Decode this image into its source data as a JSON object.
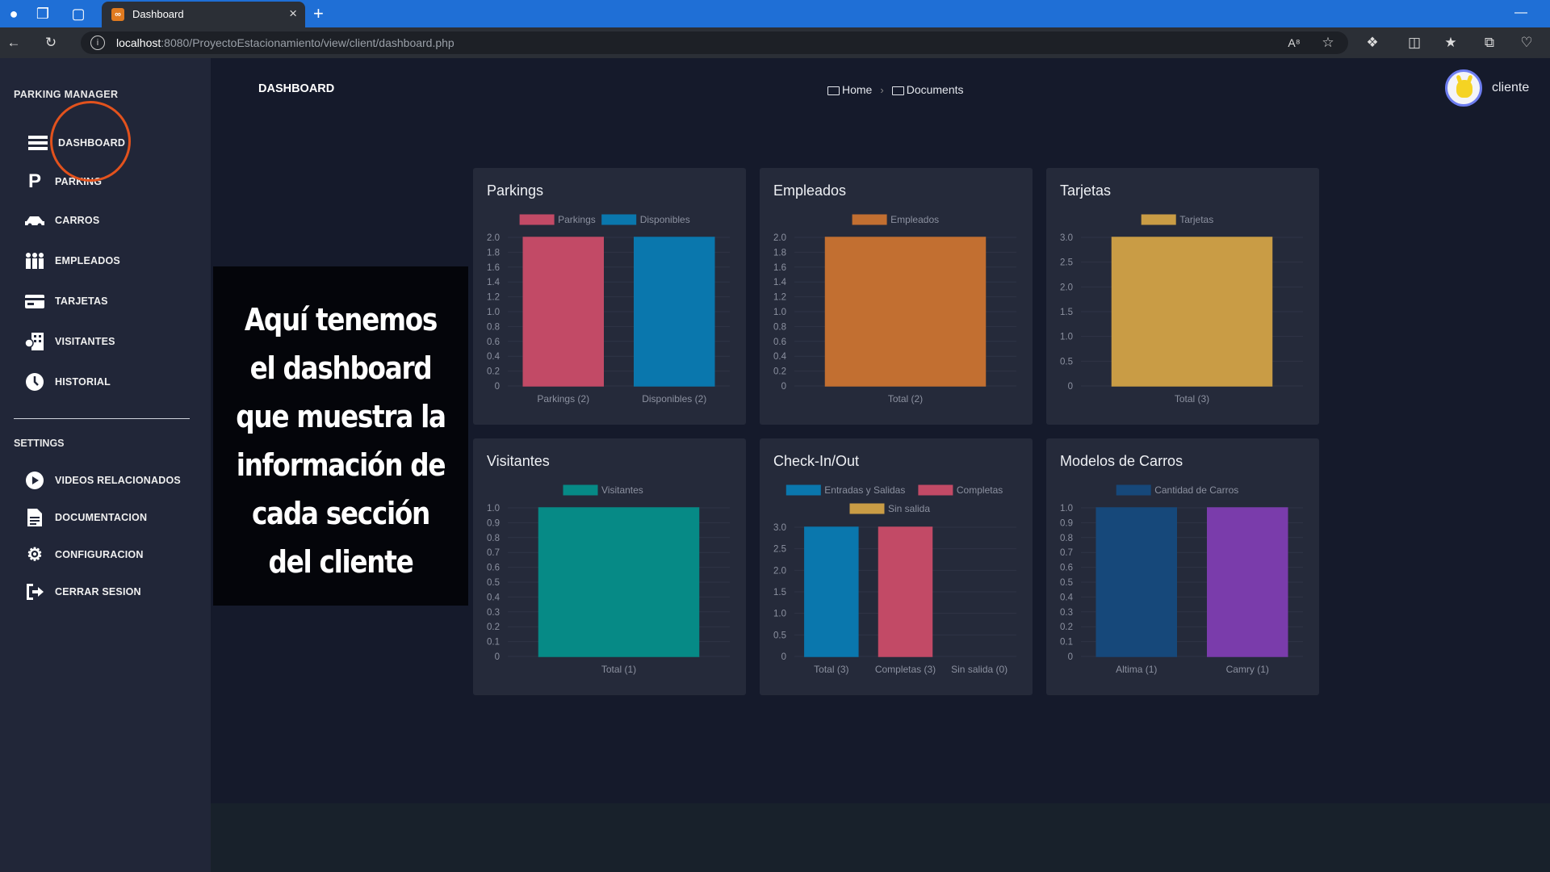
{
  "browser": {
    "tab_title": "Dashboard",
    "url_host": "localhost",
    "url_path": ":8080/ProyectoEstacionamiento/view/client/dashboard.php"
  },
  "sidebar": {
    "brand": "PARKING MANAGER",
    "items": [
      {
        "label": "DASHBOARD",
        "icon": "menu-icon"
      },
      {
        "label": "PARKING",
        "icon": "parking-icon"
      },
      {
        "label": "CARROS",
        "icon": "car-icon"
      },
      {
        "label": "EMPLEADOS",
        "icon": "people-icon"
      },
      {
        "label": "TARJETAS",
        "icon": "card-icon"
      },
      {
        "label": "VISITANTES",
        "icon": "visitor-icon"
      },
      {
        "label": "HISTORIAL",
        "icon": "clock-icon"
      }
    ],
    "settings_title": "SETTINGS",
    "settings": [
      {
        "label": "VIDEOS RELACIONADOS",
        "icon": "play-icon"
      },
      {
        "label": "DOCUMENTACION",
        "icon": "document-icon"
      },
      {
        "label": "CONFIGURACION",
        "icon": "gear-icon"
      },
      {
        "label": "CERRAR SESION",
        "icon": "logout-icon"
      }
    ]
  },
  "header": {
    "title": "DASHBOARD",
    "breadcrumb": [
      "Home",
      "Documents"
    ],
    "user": "cliente"
  },
  "overlay": {
    "caption": "Aquí tenemos el dashboard que muestra la información de cada sección del cliente"
  },
  "chart_data": [
    {
      "type": "bar",
      "title": "Parkings",
      "categories": [
        "Parkings (2)",
        "Disponibles (2)"
      ],
      "series": [
        {
          "name": "Parkings",
          "values": [
            2,
            null
          ],
          "color": "#c24a66"
        },
        {
          "name": "Disponibles",
          "values": [
            null,
            2
          ],
          "color": "#0a77ad"
        }
      ],
      "ylim": [
        0,
        2
      ],
      "yticks": [
        "2.0",
        "1.8",
        "1.6",
        "1.4",
        "1.2",
        "1.0",
        "0.8",
        "0.6",
        "0.4",
        "0.2",
        "0"
      ],
      "legend_placement": "top"
    },
    {
      "type": "bar",
      "title": "Empleados",
      "categories": [
        "Total (2)"
      ],
      "series": [
        {
          "name": "Empleados",
          "values": [
            2
          ],
          "color": "#c26f31"
        }
      ],
      "ylim": [
        0,
        2
      ],
      "yticks": [
        "2.0",
        "1.8",
        "1.6",
        "1.4",
        "1.2",
        "1.0",
        "0.8",
        "0.6",
        "0.4",
        "0.2",
        "0"
      ],
      "legend_placement": "top"
    },
    {
      "type": "bar",
      "title": "Tarjetas",
      "categories": [
        "Total (3)"
      ],
      "series": [
        {
          "name": "Tarjetas",
          "values": [
            3
          ],
          "color": "#c99c45"
        }
      ],
      "ylim": [
        0,
        3
      ],
      "yticks": [
        "3.0",
        "2.5",
        "2.0",
        "1.5",
        "1.0",
        "0.5",
        "0"
      ],
      "legend_placement": "top"
    },
    {
      "type": "bar",
      "title": "Visitantes",
      "categories": [
        "Total (1)"
      ],
      "series": [
        {
          "name": "Visitantes",
          "values": [
            1
          ],
          "color": "#068a86"
        }
      ],
      "ylim": [
        0,
        1
      ],
      "yticks": [
        "1.0",
        "0.9",
        "0.8",
        "0.7",
        "0.6",
        "0.5",
        "0.4",
        "0.3",
        "0.2",
        "0.1",
        "0"
      ],
      "legend_placement": "top"
    },
    {
      "type": "bar",
      "title": "Check-In/Out",
      "categories": [
        "Total (3)",
        "Completas (3)",
        "Sin salida (0)"
      ],
      "series": [
        {
          "name": "Entradas y Salidas",
          "values": [
            3,
            null,
            null
          ],
          "color": "#0a77ad"
        },
        {
          "name": "Completas",
          "values": [
            null,
            3,
            null
          ],
          "color": "#c24a66"
        },
        {
          "name": "Sin salida",
          "values": [
            null,
            null,
            0
          ],
          "color": "#c99c45"
        }
      ],
      "ylim": [
        0,
        3
      ],
      "yticks": [
        "3.0",
        "2.5",
        "2.0",
        "1.5",
        "1.0",
        "0.5",
        "0"
      ],
      "legend_placement": "top"
    },
    {
      "type": "bar",
      "title": "Modelos de Carros",
      "categories": [
        "Altima (1)",
        "Camry (1)"
      ],
      "series": [
        {
          "name": "Cantidad de Carros",
          "values": [
            1,
            1
          ],
          "colors": [
            "#16487a",
            "#7a3cab"
          ],
          "color": "#16487a"
        }
      ],
      "ylim": [
        0,
        1
      ],
      "yticks": [
        "1.0",
        "0.9",
        "0.8",
        "0.7",
        "0.6",
        "0.5",
        "0.4",
        "0.3",
        "0.2",
        "0.1",
        "0"
      ],
      "legend_placement": "top"
    }
  ]
}
